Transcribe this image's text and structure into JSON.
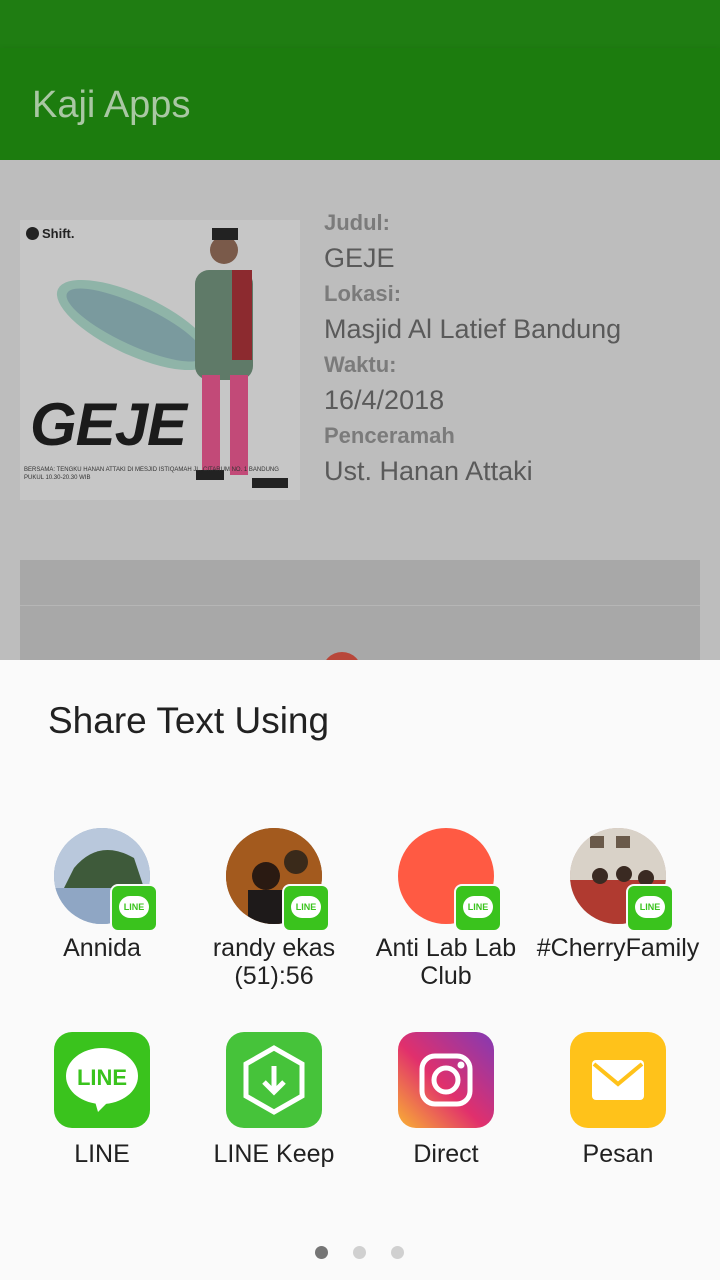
{
  "app": {
    "title": "Kaji Apps"
  },
  "event": {
    "poster_logo": "Shift.",
    "poster_title": "GEJE",
    "poster_caption": "BERSAMA: TENGKU HANAN ATTAKI DI MESJID ISTIQAMAH JL. CITARUM NO. 1 BANDUNG PUKUL 10.30-20.30 WIB",
    "labels": {
      "title": "Judul:",
      "location": "Lokasi:",
      "time": "Waktu:",
      "speaker": "Penceramah"
    },
    "values": {
      "title": "GEJE",
      "location": "Masjid Al Latief Bandung",
      "time": "16/4/2018",
      "speaker": "Ust. Hanan Attaki"
    }
  },
  "share_sheet": {
    "title": "Share Text Using",
    "direct_targets": [
      {
        "label": "Annida",
        "badge": "LINE",
        "avatar_color": "#8fa6c4"
      },
      {
        "label": "randy ekas (51):56",
        "badge": "LINE",
        "avatar_color": "#8a4a1c"
      },
      {
        "label": "Anti Lab Lab Club",
        "badge": "LINE",
        "avatar_color": "#ff5a43"
      },
      {
        "label": "#CherryFamily",
        "badge": "LINE",
        "avatar_color": "#c9a8a0"
      }
    ],
    "apps": [
      {
        "label": "LINE",
        "icon": "line-icon",
        "color": "#3ac31d"
      },
      {
        "label": "LINE Keep",
        "icon": "line-keep-icon",
        "color": "#46c33a"
      },
      {
        "label": "Direct",
        "icon": "instagram-direct-icon",
        "color": "#c13584"
      },
      {
        "label": "Pesan",
        "icon": "messages-icon",
        "color": "#ffc21a"
      }
    ],
    "page_count": 3,
    "active_page": 1
  }
}
